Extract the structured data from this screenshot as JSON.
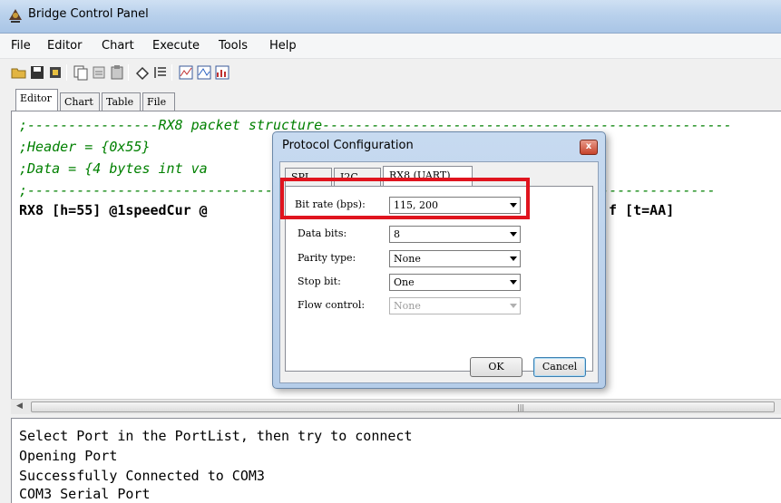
{
  "window": {
    "title": "Bridge Control Panel"
  },
  "menu": [
    "File",
    "Editor",
    "Chart",
    "Execute",
    "Tools",
    "Help"
  ],
  "toolbar": {
    "icons": [
      "open-icon",
      "save-icon",
      "connect-icon",
      "copy-icon",
      "cut-icon",
      "paste-icon",
      "clear-icon",
      "list-icon",
      "chart-icon",
      "chart-xy-icon",
      "chart-bar-icon"
    ]
  },
  "tabs": [
    "Editor",
    "Chart",
    "Table",
    "File"
  ],
  "editor": {
    "lines": [
      ";----------------RX8 packet structure--------------------------------------------------",
      ";Header = {0x55}",
      ";Data = {4 bytes int va",
      ";------------------------------------------------------------------------------------",
      "RX8 [h=55] @1speedCur @"
    ],
    "line5_tail": "f [t=AA]"
  },
  "log": {
    "lines": [
      "Select Port in the PortList, then try to connect",
      "Opening Port",
      "Successfully Connected to COM3",
      "COM3 Serial Port"
    ]
  },
  "dialog": {
    "title": "Protocol Configuration",
    "close": "x",
    "tabs": [
      "SPI",
      "I2C",
      "RX8 (UART)"
    ],
    "fields": [
      {
        "label": "Bit rate (bps):",
        "value": "115, 200",
        "enabled": true
      },
      {
        "label": "Data bits:",
        "value": "8",
        "enabled": true
      },
      {
        "label": "Parity type:",
        "value": "None",
        "enabled": true
      },
      {
        "label": "Stop bit:",
        "value": "One",
        "enabled": true
      },
      {
        "label": "Flow control:",
        "value": "None",
        "enabled": false
      }
    ],
    "ok": "OK",
    "cancel": "Cancel"
  },
  "colors": {
    "highlight": "#e0141e",
    "comment": "#008000"
  }
}
